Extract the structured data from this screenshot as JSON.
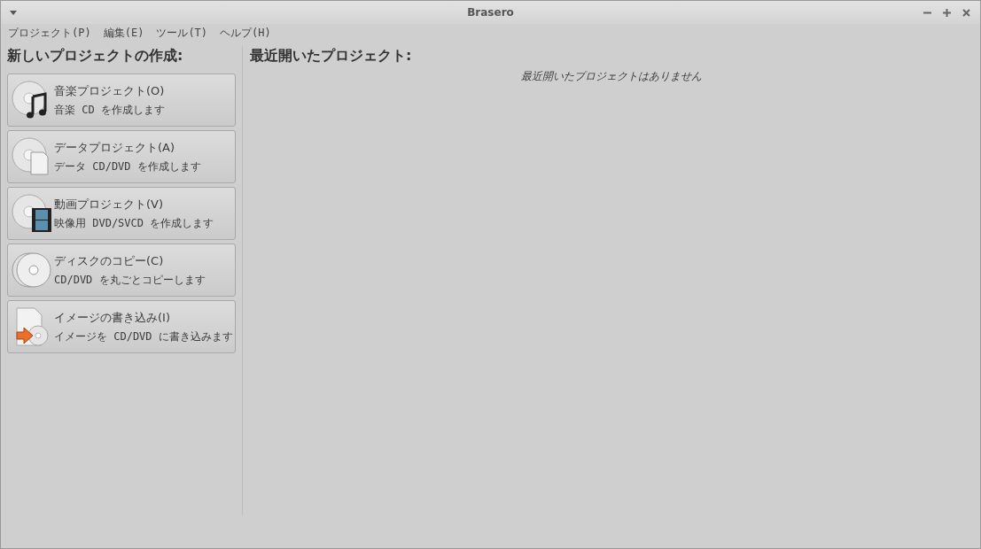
{
  "window": {
    "title": "Brasero"
  },
  "menu": [
    {
      "label": "プロジェクト(P)"
    },
    {
      "label": "編集(E)"
    },
    {
      "label": "ツール(T)"
    },
    {
      "label": "ヘルプ(H)"
    }
  ],
  "new_project": {
    "heading": "新しいプロジェクトの作成:",
    "items": [
      {
        "kind": "music",
        "title": "音楽プロジェクト(O)",
        "description": "音楽 CD を作成します"
      },
      {
        "kind": "data",
        "title": "データプロジェクト(A)",
        "description": "データ CD/DVD を作成します"
      },
      {
        "kind": "video",
        "title": "動画プロジェクト(V)",
        "description": "映像用 DVD/SVCD を作成します"
      },
      {
        "kind": "copy",
        "title": "ディスクのコピー(C)",
        "description": "CD/DVD を丸ごとコピーします"
      },
      {
        "kind": "image",
        "title": "イメージの書き込み(I)",
        "description": "イメージを CD/DVD に書き込みます"
      }
    ]
  },
  "recent": {
    "heading": "最近開いたプロジェクト:",
    "empty_message": "最近開いたプロジェクトはありません"
  }
}
